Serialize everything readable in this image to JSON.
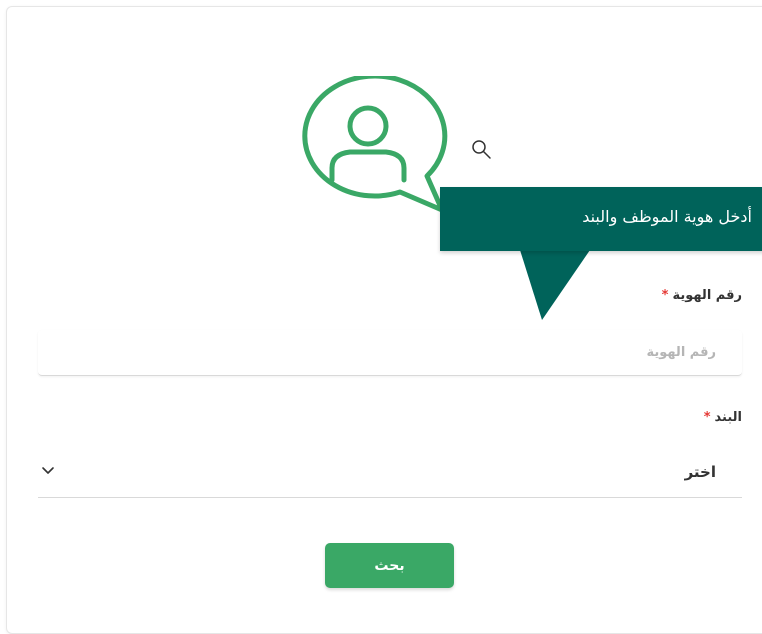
{
  "tooltip": {
    "text": "أدخل هوية الموظف والبند"
  },
  "form": {
    "id_label": "رقم الهوية",
    "id_placeholder": "رقم الهوية",
    "id_value": "",
    "item_label": "البند",
    "item_selected": "اختر",
    "required_mark": "*",
    "search_label": "بحث"
  },
  "icons": {
    "illustration": "user-speech-bubble-icon",
    "search": "search-icon",
    "dropdown": "chevron-down-icon"
  },
  "colors": {
    "accent": "#3aa866",
    "tooltip_bg": "#00635a",
    "required": "#e53935",
    "illustration": "#3aa866"
  }
}
